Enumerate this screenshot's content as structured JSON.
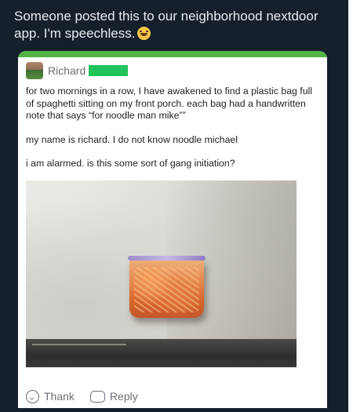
{
  "tweet": {
    "caption": "Someone posted this to our neighborhood nextdoor app. I'm speechless."
  },
  "post": {
    "author": "Richard",
    "paragraphs": [
      "for two mornings in a row, I have awakened to find a plastic bag full of spaghetti sitting on my front porch. each bag had a handwritten note that says “for noodle man mike””",
      "my name is richard. I do not know noodle michael",
      "i am alarmed. is this some sort of gang initiation?"
    ],
    "actions": {
      "thank_label": "Thank",
      "reply_label": "Reply"
    }
  },
  "colors": {
    "tweet_background": "#16202b",
    "nextdoor_green": "#52b447",
    "redaction_green": "#22c35b"
  },
  "icons": [
    "grinning-sweat-emoji-icon",
    "smile-icon",
    "reply-icon"
  ]
}
